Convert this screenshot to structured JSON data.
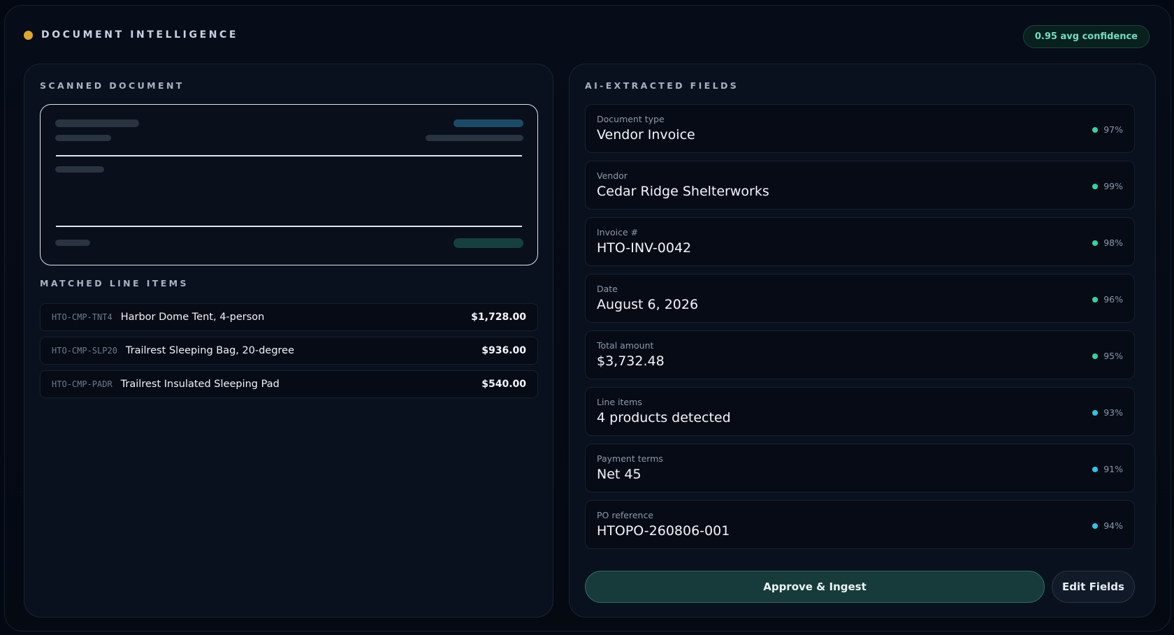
{
  "header": {
    "title": "DOCUMENT INTELLIGENCE",
    "confidence_badge": "0.95 avg confidence",
    "status_dot_color": "#e0a52b"
  },
  "left_panel": {
    "scanned_label": "SCANNED DOCUMENT",
    "line_items_label": "MATCHED LINE ITEMS",
    "line_items": [
      {
        "sku": "HTO-CMP-TNT4",
        "name": "Harbor Dome Tent, 4-person",
        "amount": "$1,728.00"
      },
      {
        "sku": "HTO-CMP-SLP20",
        "name": "Trailrest Sleeping Bag, 20-degree",
        "amount": "$936.00"
      },
      {
        "sku": "HTO-CMP-PADR",
        "name": "Trailrest Insulated Sleeping Pad",
        "amount": "$540.00"
      }
    ]
  },
  "right_panel": {
    "fields_label": "AI-EXTRACTED FIELDS",
    "fields": [
      {
        "label": "Document type",
        "value": "Vendor Invoice",
        "confidence": "97%",
        "dot_color": "#2fd6a0"
      },
      {
        "label": "Vendor",
        "value": "Cedar Ridge Shelterworks",
        "confidence": "99%",
        "dot_color": "#2fd6a0"
      },
      {
        "label": "Invoice #",
        "value": "HTO-INV-0042",
        "confidence": "98%",
        "dot_color": "#2fd6a0"
      },
      {
        "label": "Date",
        "value": "August 6, 2026",
        "confidence": "96%",
        "dot_color": "#2fd6a0"
      },
      {
        "label": "Total amount",
        "value": "$3,732.48",
        "confidence": "95%",
        "dot_color": "#2fd6a0"
      },
      {
        "label": "Line items",
        "value": "4 products detected",
        "confidence": "93%",
        "dot_color": "#2bc6e8"
      },
      {
        "label": "Payment terms",
        "value": "Net 45",
        "confidence": "91%",
        "dot_color": "#2bc6e8"
      },
      {
        "label": "PO reference",
        "value": "HTOPO-260806-001",
        "confidence": "94%",
        "dot_color": "#2bc6e8"
      }
    ],
    "approve_label": "Approve & Ingest",
    "edit_label": "Edit Fields"
  }
}
